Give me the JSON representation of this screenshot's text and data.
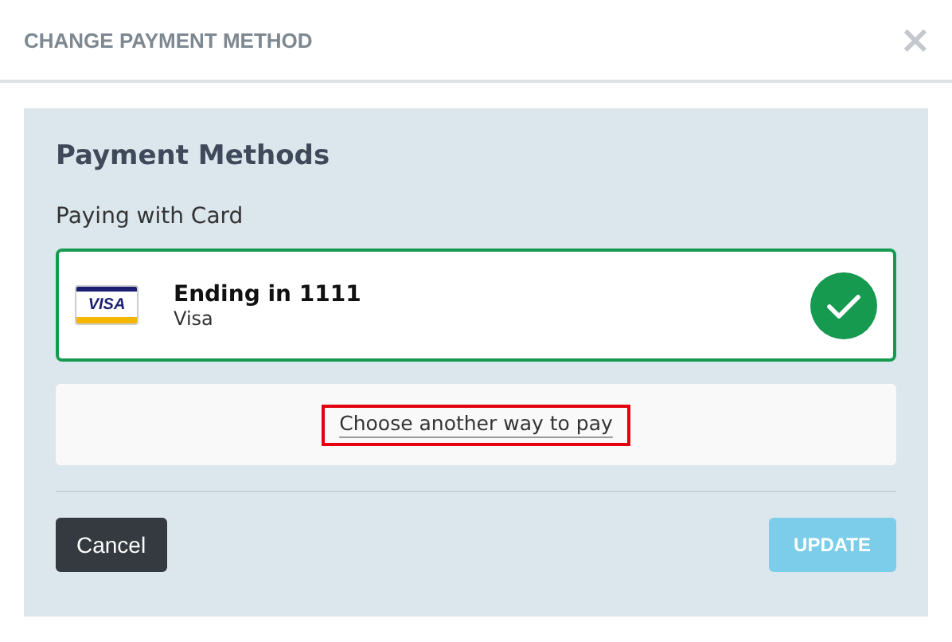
{
  "dialog": {
    "title": "CHANGE PAYMENT METHOD",
    "close": "×"
  },
  "panel": {
    "heading": "Payment Methods",
    "subheading": "Paying with Card",
    "card": {
      "logo_text": "VISA",
      "title": "Ending in 1111",
      "brand": "Visa",
      "selected": true
    },
    "alternative_link": {
      "label": "Choose another way to pay",
      "highlighted": true
    }
  },
  "buttons": [
    {
      "label": "Cancel",
      "kind": "secondary",
      "disabled": false
    },
    {
      "label": "UPDATE",
      "kind": "primary",
      "disabled": true
    }
  ]
}
